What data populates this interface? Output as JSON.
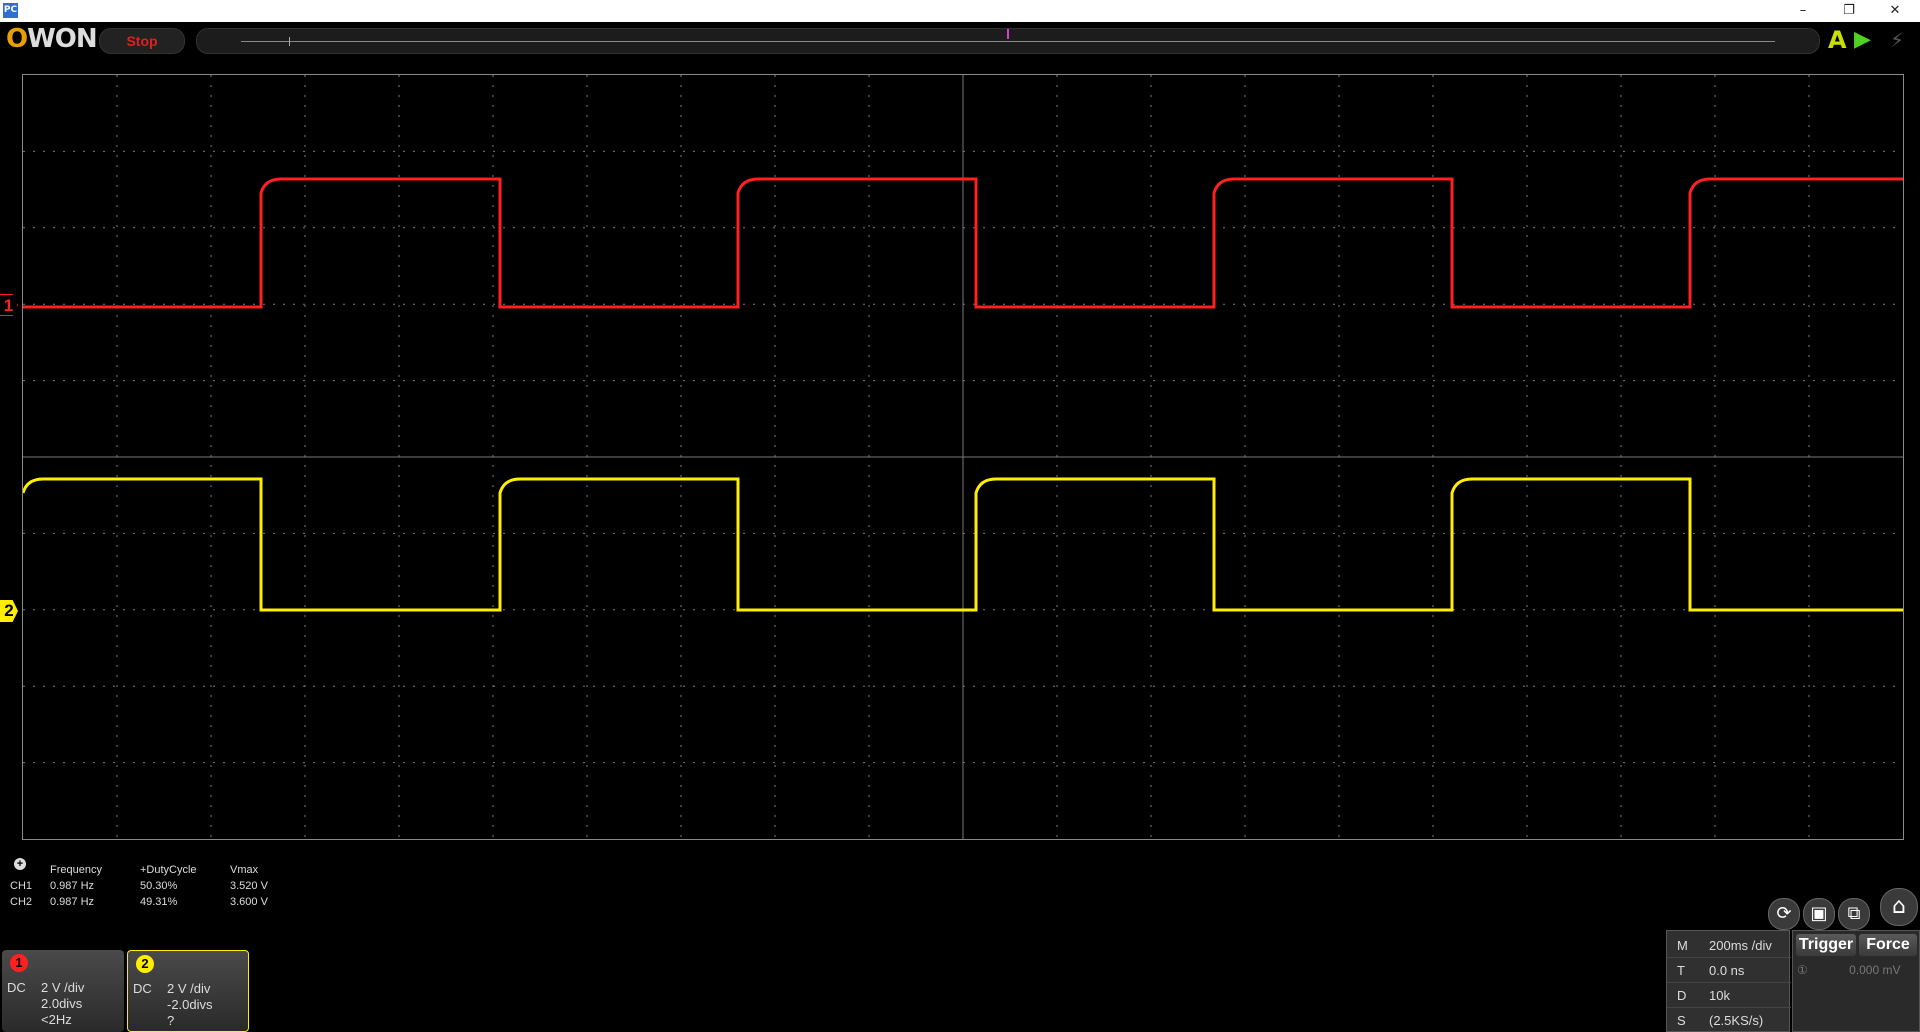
{
  "window": {
    "app_icon": "PC",
    "minimize": "–",
    "restore": "❐",
    "close": "✕"
  },
  "toolbar": {
    "logo": "OWON",
    "run_state": "Stop",
    "auto_icon": "A",
    "run_icon": "▶",
    "bolt_icon": "⚡"
  },
  "channel_markers": {
    "ch1": "1",
    "ch2": "2"
  },
  "measurements": {
    "headers": [
      "Frequency",
      "+DutyCycle",
      "Vmax"
    ],
    "rows": [
      {
        "ch": "CH1",
        "frequency": "0.987 Hz",
        "duty": "50.30%",
        "vmax": "3.520 V"
      },
      {
        "ch": "CH2",
        "frequency": "0.987 Hz",
        "duty": "49.31%",
        "vmax": "3.600 V"
      }
    ]
  },
  "channels": [
    {
      "badge": "1",
      "coupling": "DC",
      "scale": "2 V /div",
      "offset": "2.0divs",
      "freq": "<2Hz",
      "color": "#ff2020"
    },
    {
      "badge": "2",
      "coupling": "DC",
      "scale": "2 V /div",
      "offset": "-2.0divs",
      "freq": "?",
      "color": "#ffee00"
    }
  ],
  "timebase": {
    "rows": [
      {
        "k": "M",
        "v": "200ms /div"
      },
      {
        "k": "T",
        "v": "0.0 ns"
      },
      {
        "k": "D",
        "v": "10k"
      },
      {
        "k": "S",
        "v": "(2.5KS/s)"
      }
    ]
  },
  "trigger": {
    "trigger_label": "Trigger",
    "force_label": "Force",
    "level": "0.000 mV",
    "source": "①"
  },
  "colors": {
    "ch1": "#ff2020",
    "ch2": "#ffee00",
    "grid": "#7a7a7a"
  },
  "icons": [
    "add-measure-icon",
    "refresh-icon",
    "save-icon",
    "window-icon",
    "home-icon"
  ]
}
